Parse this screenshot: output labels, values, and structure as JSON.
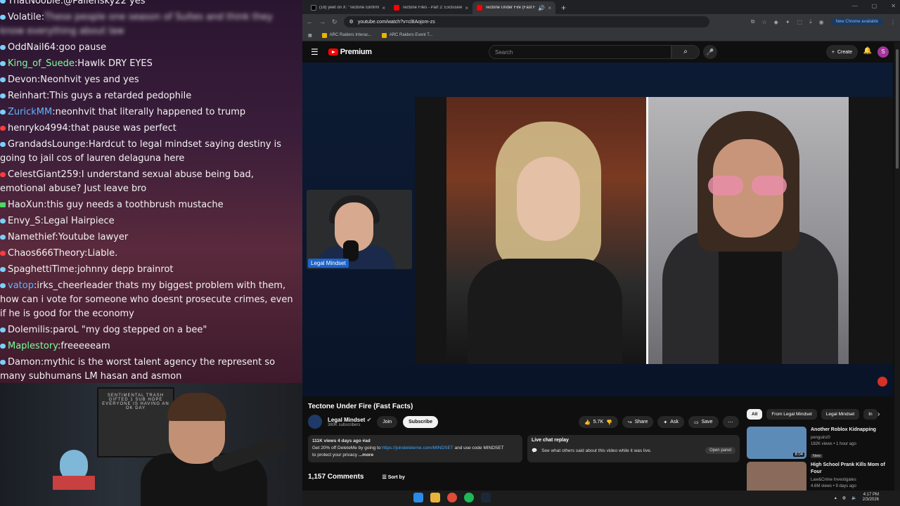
{
  "chat": {
    "messages": [
      {
        "user": "ThatNoobie",
        "text": "@Pallensky22 yes",
        "dot": "blue",
        "ucolor": ""
      },
      {
        "user": "Volatile",
        "text": "These people one season of Suites and think they know everything about law",
        "dot": "blue",
        "ucolor": "",
        "blurred": true
      },
      {
        "user": "OddNail64",
        "text": "goo pause",
        "dot": "blue",
        "ucolor": ""
      },
      {
        "user": "King_of_Suede",
        "text": "Hawlk DRY EYES",
        "dot": "blue",
        "ucolor": "green"
      },
      {
        "user": "Devon",
        "text": "Neonhvit yes and yes",
        "dot": "blue",
        "ucolor": ""
      },
      {
        "user": "Reinhart",
        "text": "This guys a retarded pedophile",
        "dot": "blue",
        "ucolor": ""
      },
      {
        "user": "ZurickMM",
        "text": "neonhvit that literally happened to trump",
        "dot": "blue",
        "ucolor": "blue"
      },
      {
        "user": "henryko4994",
        "text": "that pause was perfect",
        "dot": "red",
        "ucolor": ""
      },
      {
        "user": "GrandadsLounge",
        "text": "Hardcut to legal mindset saying destiny is going to jail cos of lauren delaguna here",
        "dot": "blue",
        "ucolor": ""
      },
      {
        "user": "CelestGiant259",
        "text": "I understand sexual abuse being bad, emotional abuse? Just leave bro",
        "dot": "red",
        "ucolor": ""
      },
      {
        "user": "HaoXun",
        "text": "this guy needs a toothbrush mustache",
        "dot": "green",
        "ucolor": ""
      },
      {
        "user": "Envy_S",
        "text": "Legal Hairpiece",
        "dot": "blue",
        "ucolor": ""
      },
      {
        "user": "Namethief",
        "text": "Youtube lawyer",
        "dot": "blue",
        "ucolor": ""
      },
      {
        "user": "Chaos666Theory",
        "text": "Liable.",
        "dot": "red",
        "ucolor": ""
      },
      {
        "user": "SpaghettiTime",
        "text": "johnny depp brainrot",
        "dot": "blue",
        "ucolor": ""
      },
      {
        "user": "vatop",
        "text": "irks_cheerleader thats my biggest problem with them, how can i vote for someone who doesnt prosecute crimes, even if he is good for the economy",
        "dot": "blue",
        "ucolor": "blue"
      },
      {
        "user": "Dolemilis",
        "text": "paroL \"my dog stepped on a bee\"",
        "dot": "blue",
        "ucolor": ""
      },
      {
        "user": "Maplestory",
        "text": "freeeeeam",
        "dot": "blue",
        "ucolor": "green"
      },
      {
        "user": "Damon",
        "text": "mythic is the worst talent agency the represent so many subhumans LM hasan and asmon",
        "dot": "blue",
        "ucolor": ""
      }
    ]
  },
  "webcam": {
    "sign_text": "SENTIMENTAL TRASH GIFTED 1 SUB HOPE EVERYONE IS HAVING AN OK DAY"
  },
  "browser": {
    "tabs": [
      {
        "title": "(18) yeet on X: \"Tectone confirm",
        "active": false
      },
      {
        "title": "Tectone Files - Part 2: Exclusive",
        "active": false
      },
      {
        "title": "Tectone Under Fire (Fast Fa...",
        "active": true
      }
    ],
    "url": "youtube.com/watch?v=cl8Aojom-zs",
    "new_chrome": "New Chrome available",
    "bookmarks": [
      "ARC Raiders Interac...",
      "ARC Raiders Event T..."
    ]
  },
  "youtube": {
    "logo": "Premium",
    "search_placeholder": "Search",
    "create": "Create",
    "avatar_letter": "S",
    "pip_label": "Legal Mindset",
    "video_title": "Tectone Under Fire (Fast Facts)",
    "channel": "Legal Mindset",
    "subscribers": "380K subscribers",
    "join": "Join",
    "subscribe": "Subscribe",
    "likes": "5.7K",
    "share": "Share",
    "ask": "Ask",
    "save": "Save",
    "desc_stats": "111K views  4 days ago  #ad",
    "desc_line1": "Get 20% off DeleteMe by going to",
    "desc_link": "https://joindeleteme.com/MINDSET",
    "desc_line1b": "and use code MINDSET",
    "desc_line2": "to protect your privacy",
    "desc_more": "...more",
    "live_chat_title": "Live chat replay",
    "live_chat_text": "See what others said about this video while it was live.",
    "open_panel": "Open panel",
    "comment_count": "1,157 Comments",
    "sort_by": "Sort by",
    "chips": [
      "All",
      "From Legal Mindset",
      "Legal Mindset",
      "In"
    ],
    "recommendations": [
      {
        "title": "Another Roblox Kidnapping",
        "channel": "penguinz0",
        "meta": "182K views • 1 hour ago",
        "badge": "New",
        "duration": "8:04",
        "thumb": "#5d8bb8"
      },
      {
        "title": "High School Prank Kills Mom of Four",
        "channel": "Law&Crime Investigates",
        "meta": "4.6M views • 9 days ago",
        "badge": "",
        "duration": "",
        "thumb": "#8a6a5a"
      }
    ]
  },
  "taskbar": {
    "time": "4:17 PM",
    "date": "2/3/2026"
  }
}
